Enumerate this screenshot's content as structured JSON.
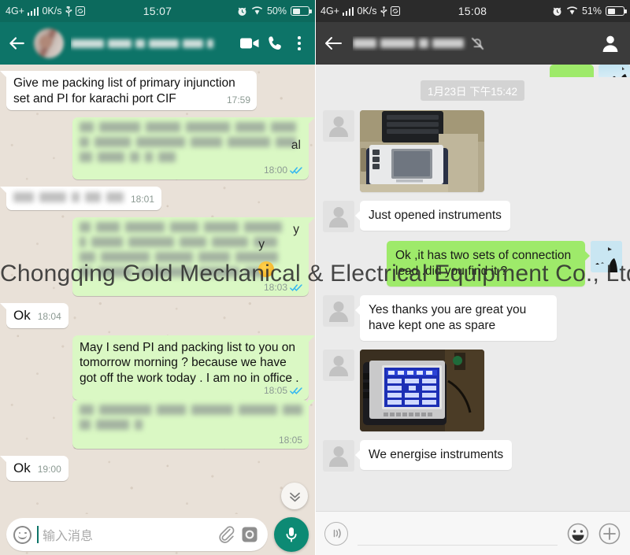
{
  "watermark": "Chongqing Gold Mechanical & Electrical Equipment Co., Ltd",
  "left_panel": {
    "app": "WhatsApp",
    "status_bar": {
      "network": "4G+",
      "speed": "0K/s",
      "signal_icon": "signal-bars-icon",
      "usb_icon": "usb-icon",
      "sync_icon": "sync-icon",
      "time": "15:07",
      "alarm_icon": "alarm-clock-icon",
      "wifi_icon": "wifi-icon",
      "battery": "50%",
      "battery_icon": "battery-icon"
    },
    "appbar": {
      "back_icon": "back-arrow-icon",
      "avatar": "contact-avatar",
      "contact_name": "",
      "video_call_icon": "video-camera-icon",
      "voice_call_icon": "phone-icon",
      "menu_icon": "overflow-menu-icon"
    },
    "messages": [
      {
        "id": "m1",
        "dir": "in",
        "text": "Give me packing list of primary injunction set and PI for karachi port CIF",
        "time": "17:59",
        "blurred": false,
        "ticks": false
      },
      {
        "id": "m2",
        "dir": "out",
        "text": "",
        "time": "18:00",
        "blurred": true,
        "ticks": true,
        "visible_fragments": [
          "al"
        ]
      },
      {
        "id": "m3",
        "dir": "in",
        "text": "",
        "time": "18:01",
        "blurred": true,
        "ticks": false,
        "short": true
      },
      {
        "id": "m4",
        "dir": "out",
        "text": "",
        "time": "18:03",
        "blurred": true,
        "ticks": true,
        "visible_fragments": [
          "y",
          "y"
        ],
        "emoji_badge": true
      },
      {
        "id": "m5",
        "dir": "in",
        "text": "Ok",
        "time": "18:04",
        "blurred": false,
        "ticks": false,
        "short": true
      },
      {
        "id": "m6",
        "dir": "out",
        "text": "May I send PI and packing list to you on tomorrow morning ? because we have got off the work today . I am no in office .",
        "time": "18:05",
        "blurred": false,
        "ticks": true
      },
      {
        "id": "m7",
        "dir": "out",
        "text": "",
        "time": "18:05",
        "blurred": true,
        "ticks": false
      },
      {
        "id": "m8",
        "dir": "in",
        "text": "Ok",
        "time": "19:00",
        "blurred": false,
        "ticks": false,
        "short": true
      }
    ],
    "scroll_down_icon": "double-chevron-down-icon",
    "input_bar": {
      "emoji_icon": "emoji-smiley-icon",
      "placeholder": "输入消息",
      "value": "",
      "attach_icon": "paperclip-icon",
      "camera_icon": "camera-icon",
      "mic_icon": "microphone-icon"
    }
  },
  "right_panel": {
    "app": "WeChat",
    "status_bar": {
      "network": "4G+",
      "speed": "0K/s",
      "signal_icon": "signal-bars-icon",
      "usb_icon": "usb-icon",
      "sync_icon": "sync-icon",
      "time": "15:08",
      "alarm_icon": "alarm-clock-icon",
      "wifi_icon": "wifi-icon",
      "battery": "51%",
      "battery_icon": "battery-icon"
    },
    "appbar": {
      "back_icon": "back-arrow-icon",
      "contact_name": "",
      "mute_icon": "mute-bell-icon",
      "profile_icon": "contact-profile-icon"
    },
    "date_chip": "1月23日 下午15:42",
    "messages": [
      {
        "id": "r0",
        "dir": "out",
        "type": "partial",
        "text": ""
      },
      {
        "id": "r1",
        "dir": "in",
        "type": "image",
        "caption": "instrument-case-photo"
      },
      {
        "id": "r2",
        "dir": "in",
        "type": "text",
        "text": "Just opened instruments"
      },
      {
        "id": "r3",
        "dir": "out",
        "type": "text",
        "text": "Ok ,it has two sets of connection lead .did you find it ?"
      },
      {
        "id": "r4",
        "dir": "in",
        "type": "text",
        "text": "Yes thanks you are great you have kept one as spare"
      },
      {
        "id": "r5",
        "dir": "in",
        "type": "image",
        "caption": "energised-instrument-photo"
      },
      {
        "id": "r6",
        "dir": "in",
        "type": "text",
        "text": "We energise instruments"
      }
    ],
    "input_bar": {
      "voice_icon": "voice-wave-icon",
      "placeholder": "",
      "value": "",
      "emoji_icon": "emoji-smiley-icon",
      "plus_icon": "plus-icon"
    }
  },
  "colors": {
    "whatsapp_header": "#0d7468",
    "whatsapp_statusbar": "#0c6a5d",
    "whatsapp_out_bubble": "#daf8c4",
    "whatsapp_chat_bg": "#e9e1d8",
    "whatsapp_mic": "#0d8a74",
    "wechat_header": "#3b3b3b",
    "wechat_statusbar": "#2b2b2b",
    "wechat_out_bubble": "#9eea6a",
    "wechat_chat_bg": "#ebebeb",
    "tick_blue": "#34b7f1"
  }
}
